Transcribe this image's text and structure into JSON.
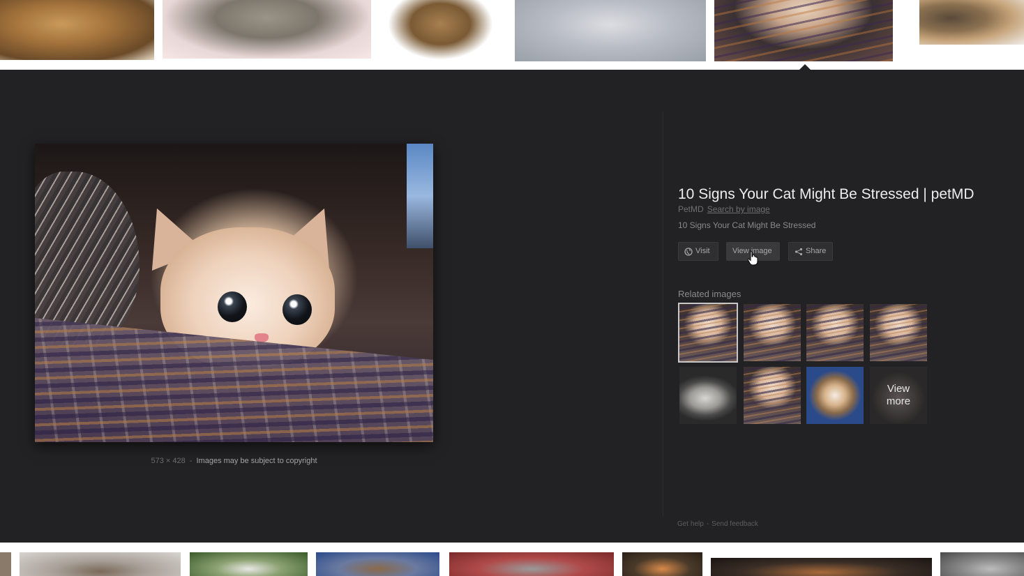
{
  "preview": {
    "image_dimensions": "573 × 428",
    "separator": "-",
    "copyright_note": "Images may be subject to copyright"
  },
  "info": {
    "title": "10 Signs Your Cat Might Be Stressed | petMD",
    "source_name": "PetMD",
    "search_by_image": "Search by image",
    "description": "10 Signs Your Cat Might Be Stressed",
    "buttons": {
      "visit": "Visit",
      "view_image": "View image",
      "share": "Share"
    },
    "related_label": "Related images",
    "view_more_line1": "View",
    "view_more_line2": "more"
  },
  "footer": {
    "get_help": "Get help",
    "separator": "-",
    "send_feedback": "Send feedback"
  },
  "colors": {
    "panel_background": "#222224",
    "title_text": "#ededee",
    "muted_text": "#8a8a8c"
  },
  "icons": {
    "visit": "globe-icon",
    "share": "share-icon",
    "cursor": "hand-pointer-icon"
  }
}
